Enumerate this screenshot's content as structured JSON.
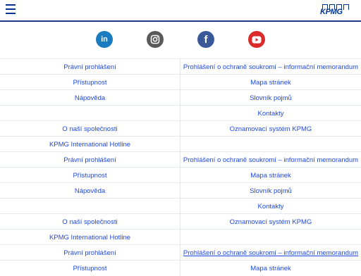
{
  "header": {
    "logo_text": "KPMG",
    "brand_color": "#00338d"
  },
  "social": {
    "linkedin": "in",
    "instagram": "instagram-icon",
    "facebook": "f",
    "youtube": "youtube-icon"
  },
  "links": {
    "rows": [
      [
        "Právní prohlášení",
        "Prohlášení o ochraně soukromí – informační memorandum"
      ],
      [
        "Přístupnost",
        "Mapa stránek"
      ],
      [
        "Nápověda",
        "Slovník pojmů"
      ],
      [
        "",
        "Kontakty"
      ],
      [
        "O naší společnosti",
        "Oznamovací systém KPMG"
      ],
      [
        "KPMG International Hotline",
        ""
      ],
      [
        "Právní prohlášení",
        "Prohlášení o ochraně soukromí – informační memorandum"
      ],
      [
        "Přístupnost",
        "Mapa stránek"
      ],
      [
        "Nápověda",
        "Slovník pojmů"
      ],
      [
        "",
        "Kontakty"
      ],
      [
        "O naší společnosti",
        "Oznamovací systém KPMG"
      ],
      [
        "KPMG International Hotline",
        ""
      ],
      [
        "Právní prohlášení",
        "Prohlášení o ochraně soukromí – informační memorandum"
      ],
      [
        "Přístupnost",
        "Mapa stránek"
      ]
    ]
  }
}
